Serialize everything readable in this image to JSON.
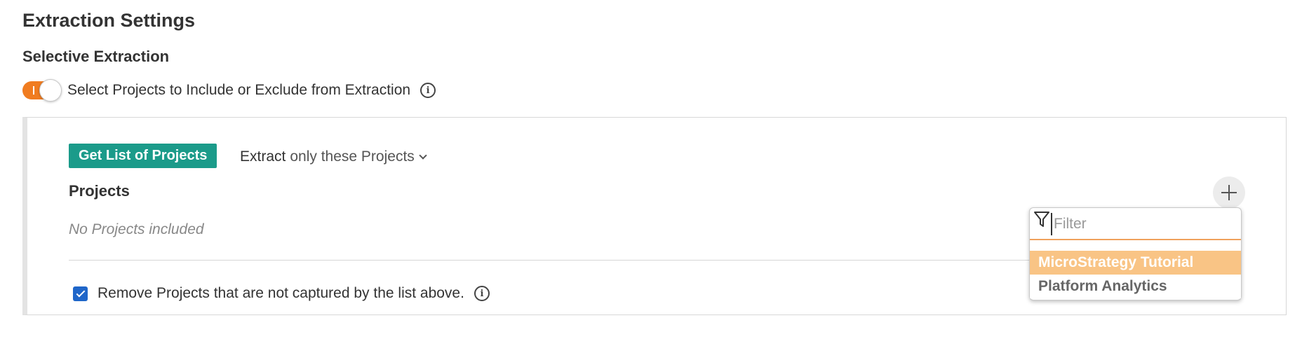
{
  "page": {
    "title": "Extraction Settings",
    "subtitle": "Selective Extraction"
  },
  "toggle": {
    "label": "Select Projects to Include or Exclude from Extraction",
    "state": "on",
    "accent_color": "#f07c20"
  },
  "panel": {
    "get_list_button": "Get List of Projects",
    "extract_label": "Extract",
    "extract_mode": "only these Projects",
    "projects_heading": "Projects",
    "empty_message": "No Projects included",
    "remove_checkbox_label": "Remove Projects that are not captured by the list above.",
    "remove_checked": true,
    "button_color": "#1b9b8a"
  },
  "dropdown": {
    "filter_placeholder": "Filter",
    "options": [
      {
        "label": "MicroStrategy Tutorial",
        "highlighted": true
      },
      {
        "label": "Platform Analytics",
        "highlighted": false
      }
    ],
    "highlight_color": "#f9c485"
  },
  "icons": {
    "info": "info-icon",
    "add": "plus-icon",
    "filter": "filter-icon",
    "chevron": "chevron-down-icon",
    "check": "check-icon"
  }
}
